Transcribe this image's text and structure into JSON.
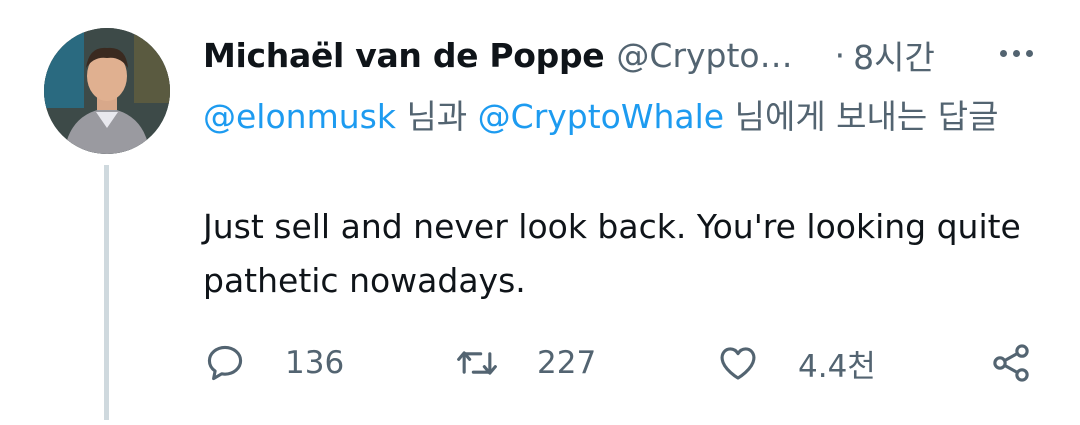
{
  "tweet": {
    "author_name": "Michaël van de Poppe",
    "author_handle": "@Crypto…",
    "separator": "·",
    "time": "8시간",
    "reply_to": {
      "mention1": "@elonmusk",
      "connector1": " 님과 ",
      "mention2": "@CryptoWhale",
      "connector2": " 님에게 보내는 답글"
    },
    "text": "Just sell and never look back. You're looking quite pathetic nowadays.",
    "stats": {
      "replies": "136",
      "retweets": "227",
      "likes": "4.4천"
    }
  },
  "icons": {
    "reply": "reply-bubble-icon",
    "retweet": "retweet-icon",
    "like": "heart-icon",
    "share": "share-icon",
    "more": "more-dots-icon"
  },
  "colors": {
    "link": "#1d9bf0",
    "secondary": "#536471",
    "primary": "#0f1419",
    "thread_line": "#cfd9de"
  }
}
